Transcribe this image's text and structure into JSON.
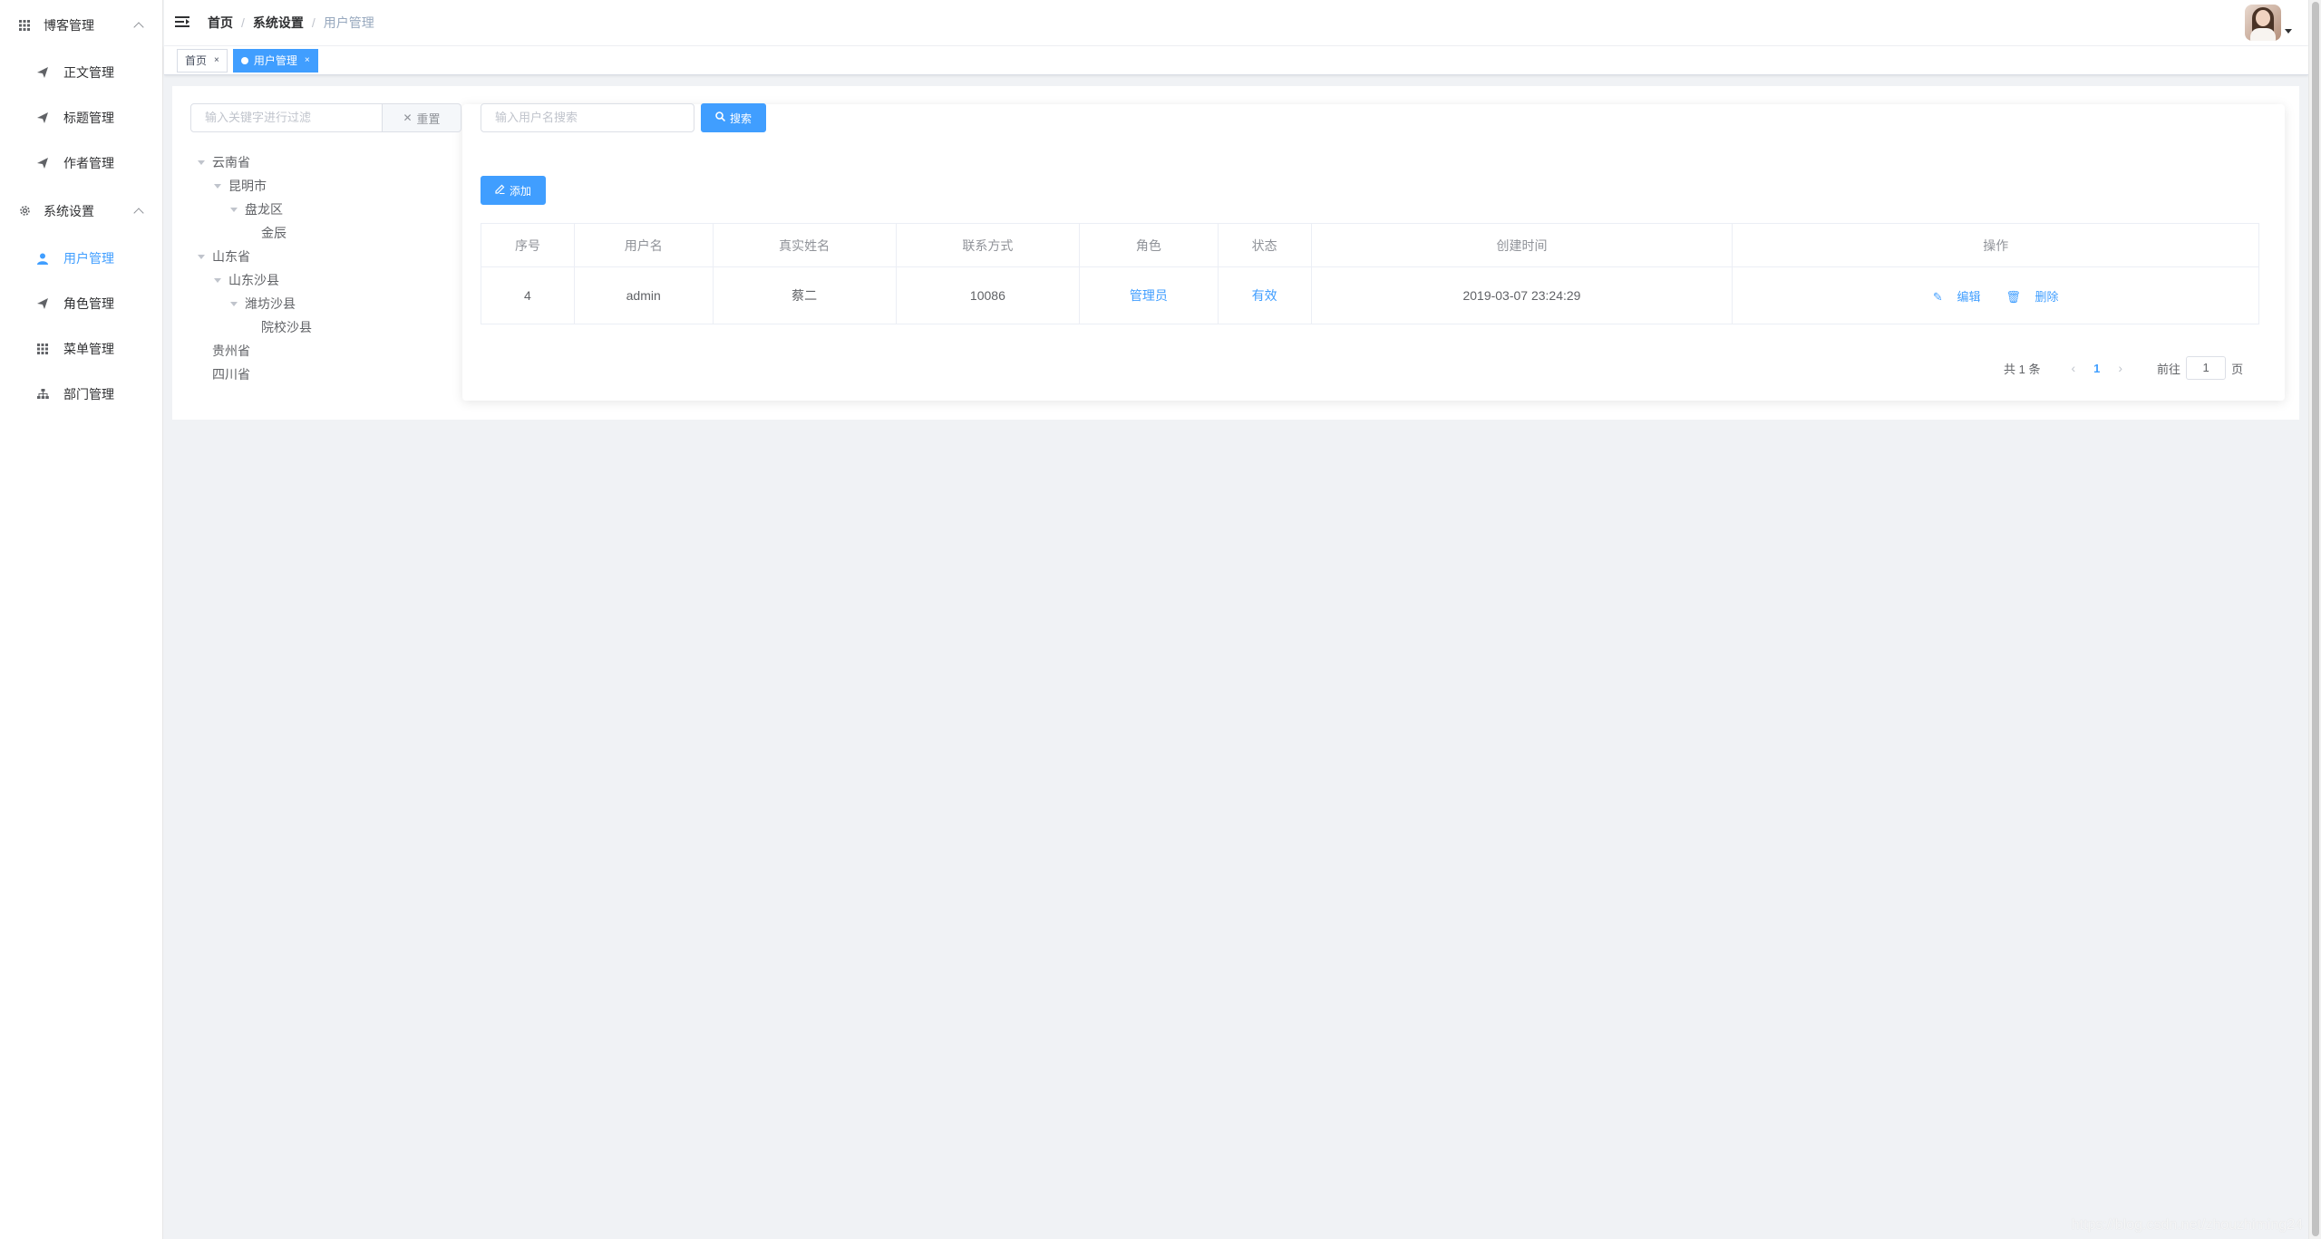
{
  "sidebar": {
    "groups": [
      {
        "label": "博客管理",
        "icon": "grid-icon",
        "items": [
          {
            "label": "正文管理",
            "icon": "send-icon"
          },
          {
            "label": "标题管理",
            "icon": "send-icon"
          },
          {
            "label": "作者管理",
            "icon": "send-icon"
          }
        ]
      },
      {
        "label": "系统设置",
        "icon": "gear-icon",
        "items": [
          {
            "label": "用户管理",
            "icon": "user-icon",
            "active": true
          },
          {
            "label": "角色管理",
            "icon": "send-icon"
          },
          {
            "label": "菜单管理",
            "icon": "grid-icon"
          },
          {
            "label": "部门管理",
            "icon": "org-icon"
          }
        ]
      }
    ]
  },
  "header": {
    "breadcrumb": [
      "首页",
      "系统设置",
      "用户管理"
    ]
  },
  "tags": [
    {
      "label": "首页",
      "active": false
    },
    {
      "label": "用户管理",
      "active": true
    }
  ],
  "filter": {
    "placeholder": "输入关键字进行过滤",
    "reset_label": "重置"
  },
  "tree": [
    {
      "label": "云南省",
      "level": 0,
      "expanded": true
    },
    {
      "label": "昆明市",
      "level": 1,
      "expanded": true
    },
    {
      "label": "盘龙区",
      "level": 2,
      "expanded": true
    },
    {
      "label": "金辰",
      "level": 3,
      "expanded": false
    },
    {
      "label": "山东省",
      "level": 0,
      "expanded": true
    },
    {
      "label": "山东沙县",
      "level": 1,
      "expanded": true
    },
    {
      "label": "潍坊沙县",
      "level": 2,
      "expanded": true
    },
    {
      "label": "院校沙县",
      "level": 3,
      "expanded": false
    },
    {
      "label": "贵州省",
      "level": 0,
      "expanded": false
    },
    {
      "label": "四川省",
      "level": 0,
      "expanded": false
    }
  ],
  "search": {
    "placeholder": "输入用户名搜索",
    "button_label": "搜索"
  },
  "add_label": "添加",
  "table": {
    "columns": [
      "序号",
      "用户名",
      "真实姓名",
      "联系方式",
      "角色",
      "状态",
      "创建时间",
      "操作"
    ],
    "rows": [
      {
        "index": "4",
        "username": "admin",
        "realname": "蔡二",
        "contact": "10086",
        "role": "管理员",
        "status": "有效",
        "created": "2019-03-07 23:24:29",
        "edit_label": "编辑",
        "delete_label": "删除"
      }
    ]
  },
  "pagination": {
    "total_text": "共 1 条",
    "current_page": "1",
    "goto_prefix": "前往",
    "goto_value": "1",
    "goto_suffix": "页"
  },
  "watermark": "https://blog.csdn.net/zhouzhiming24",
  "colors": {
    "primary": "#409eff",
    "background": "#f0f2f5"
  }
}
